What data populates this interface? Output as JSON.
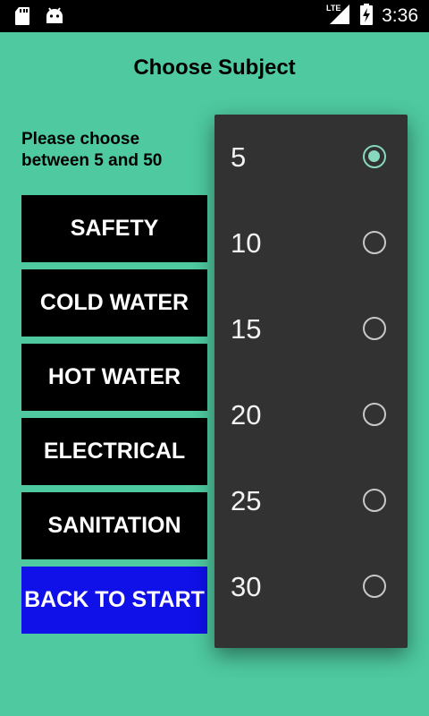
{
  "status_bar": {
    "time": "3:36",
    "network": "LTE",
    "left_icons": [
      "sd-card-icon",
      "android-icon"
    ]
  },
  "header": {
    "title": "Choose Subject"
  },
  "hint": "Please choose between 5 and 50",
  "subjects": [
    {
      "label": "SAFETY"
    },
    {
      "label": "COLD WATER"
    },
    {
      "label": "HOT WATER"
    },
    {
      "label": "ELECTRICAL"
    },
    {
      "label": "SANITATION"
    }
  ],
  "back_button": {
    "label": "BACK TO START"
  },
  "dialog": {
    "options": [
      {
        "label": "5",
        "checked": true
      },
      {
        "label": "10",
        "checked": false
      },
      {
        "label": "15",
        "checked": false
      },
      {
        "label": "20",
        "checked": false
      },
      {
        "label": "25",
        "checked": false
      },
      {
        "label": "30",
        "checked": false
      }
    ]
  },
  "colors": {
    "background": "#4ec9a0",
    "subject_button": "#000000",
    "back_button": "#1010e8",
    "dialog": "#323232",
    "radio_accent": "#88d8c0"
  }
}
